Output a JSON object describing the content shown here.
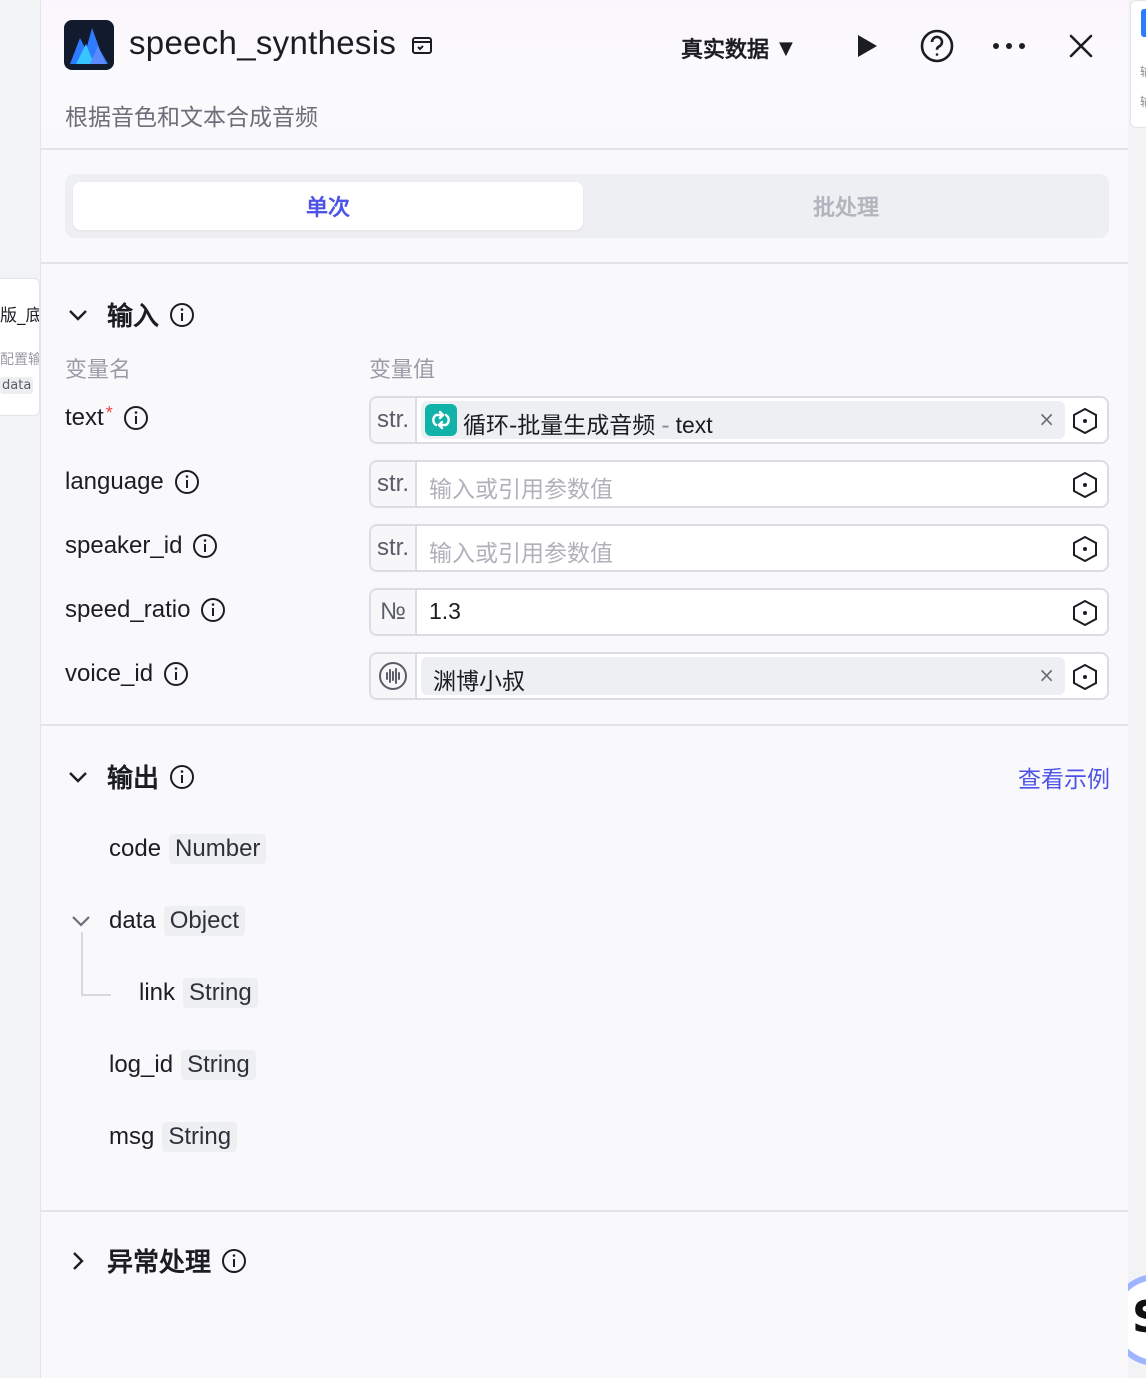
{
  "background": {
    "left_card_title": "版_底",
    "left_card_sub": "配置输",
    "left_card_tag": "data",
    "right_card_text": [
      "输",
      "输"
    ],
    "right_circle_glyph": "S"
  },
  "header": {
    "title": "speech_synthesis",
    "description": "根据音色和文本合成音频",
    "data_mode": "真实数据",
    "icons": [
      "app-logo-icon",
      "plugin-store-icon",
      "caret-down-icon",
      "play-icon",
      "help-icon",
      "more-icon",
      "close-icon"
    ]
  },
  "tabs": {
    "single": "单次",
    "batch": "批处理"
  },
  "input": {
    "label": "输入",
    "col_name": "变量名",
    "col_value": "变量值",
    "fields": [
      {
        "name": "text",
        "required_mark": "*",
        "type": "str.",
        "ref_node": "循环-批量生成音频",
        "ref_sep": "-",
        "ref_var": "text"
      },
      {
        "name": "language",
        "type": "str.",
        "placeholder": "输入或引用参数值"
      },
      {
        "name": "speaker_id",
        "type": "str.",
        "placeholder": "输入或引用参数值"
      },
      {
        "name": "speed_ratio",
        "type": "№",
        "value": "1.3"
      },
      {
        "name": "voice_id",
        "type_icon": "voice-wave-icon",
        "value": "渊博小叔"
      }
    ],
    "clear_symbol": "×"
  },
  "output": {
    "label": "输出",
    "example_link": "查看示例",
    "fields": [
      {
        "name": "code",
        "type": "Number"
      },
      {
        "name": "data",
        "type": "Object"
      },
      {
        "name": "link",
        "type": "String"
      },
      {
        "name": "log_id",
        "type": "String"
      },
      {
        "name": "msg",
        "type": "String"
      }
    ]
  },
  "error_handling": {
    "label": "异常处理"
  },
  "colors": {
    "accent": "#4d53e8",
    "loop_badge": "#11b3a8",
    "required": "#ef4444",
    "border": "#dcdde3"
  }
}
